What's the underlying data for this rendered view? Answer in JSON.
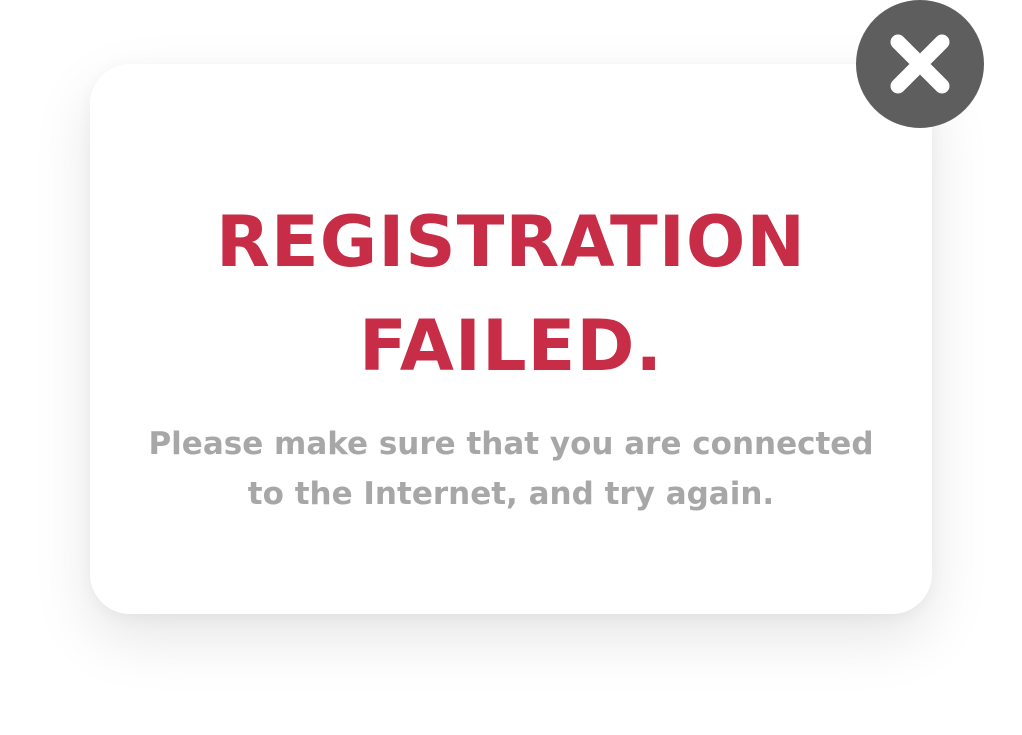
{
  "dialog": {
    "title_line1": "REGISTRATION",
    "title_line2": "FAILED.",
    "message_line1": "Please make sure that you are connected",
    "message_line2": "to the Internet, and try again."
  },
  "close_button": {
    "icon": "close-icon"
  },
  "colors": {
    "title": "#c72d47",
    "message": "#a7a7a7",
    "close_background": "#5e5e5e",
    "close_glyph": "#ffffff"
  }
}
